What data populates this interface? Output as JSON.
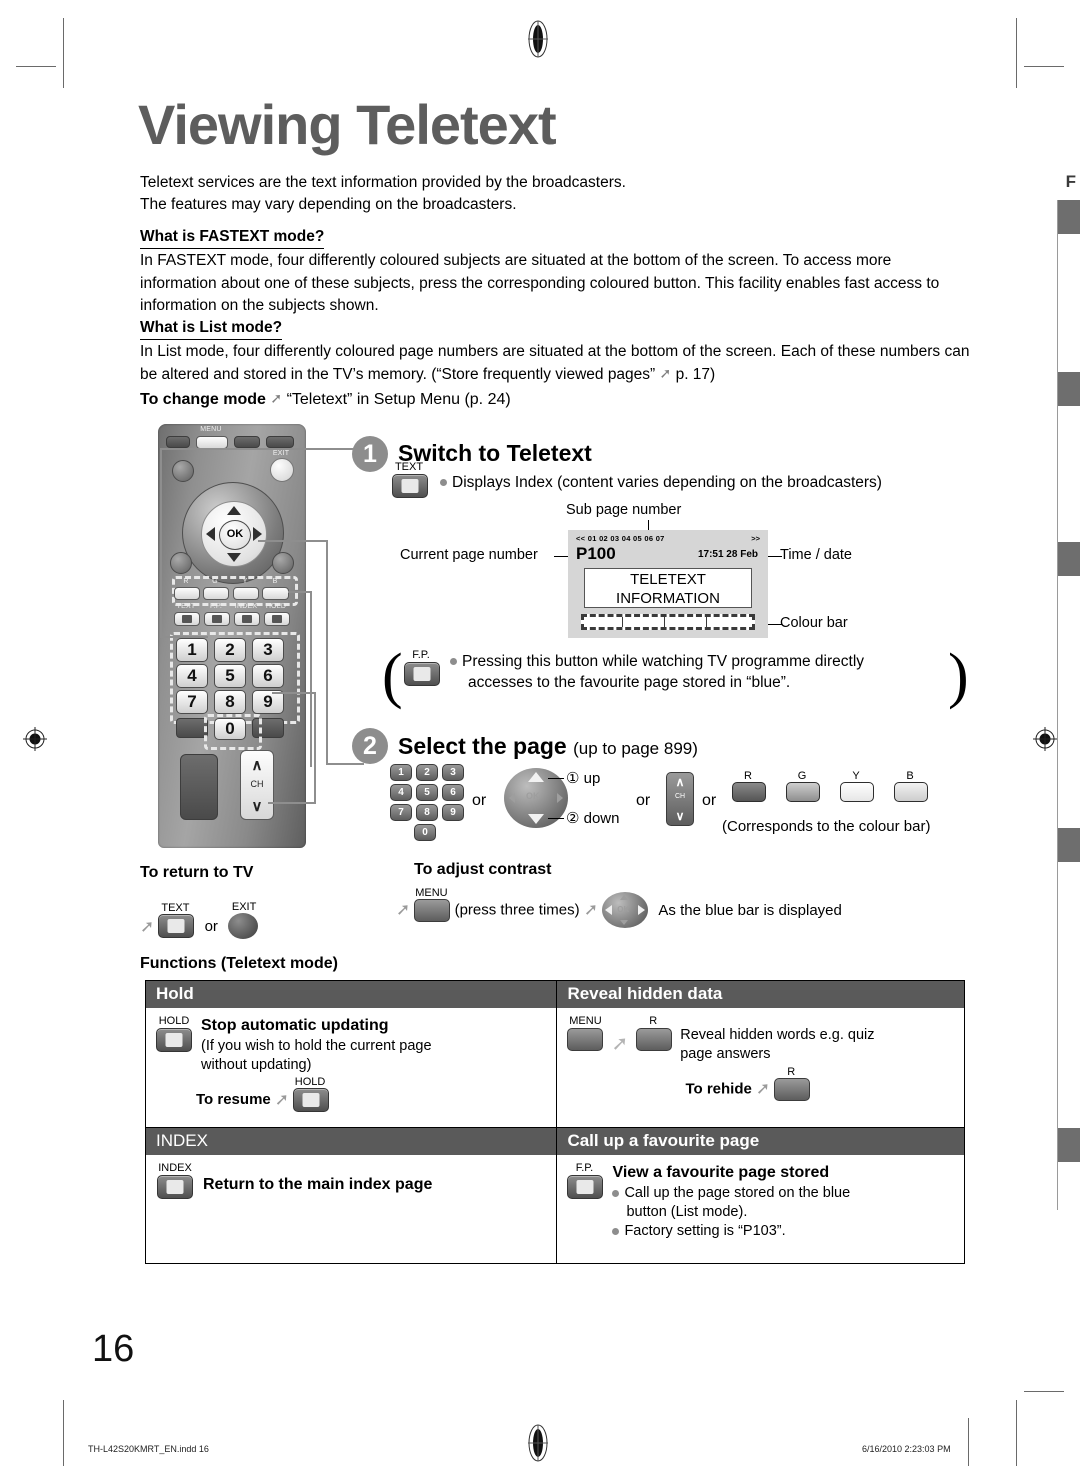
{
  "page": {
    "title": "Viewing Teletext",
    "number": "16",
    "footer_left": "TH-L42S20KMRT_EN.indd   16",
    "footer_right": "6/16/2010   2:23:03 PM",
    "edge_letter": "F"
  },
  "intro": {
    "line1": "Teletext services are the text information provided by the broadcasters.",
    "line2": "The features may vary depending on the broadcasters."
  },
  "fastext": {
    "heading": "What is FASTEXT mode?",
    "body": "In FASTEXT mode, four differently coloured subjects are situated at the bottom of the screen. To access more information about one of these subjects, press the corresponding coloured button. This facility enables fast access to information on the subjects shown."
  },
  "list_mode": {
    "heading": "What is List mode?",
    "body_1": "In List mode, four differently coloured page numbers are situated at the bottom of the screen. Each of these numbers can be altered and stored in the TV’s memory. (“Store frequently viewed pages”",
    "body_2": "p. 17)"
  },
  "change_mode": {
    "label": "To change mode",
    "value": "“Teletext” in Setup Menu (p. 24)"
  },
  "remote": {
    "menu_label": "MENU",
    "exit_label": "EXIT",
    "ok_label": "OK",
    "colour_labels": [
      "R",
      "G",
      "Y",
      "B"
    ],
    "function_labels": [
      "TEXT",
      "F.P.",
      "INDEX",
      "HOLD"
    ],
    "numbers": [
      "1",
      "2",
      "3",
      "4",
      "5",
      "6",
      "7",
      "8",
      "9",
      "0"
    ],
    "ch_label": "CH"
  },
  "step1": {
    "badge": "1",
    "title": "Switch to Teletext",
    "button_cap": "TEXT",
    "bullet": "Displays Index (content varies depending on the broadcasters)",
    "fp_cap": "F.P.",
    "fp_note_1": "Pressing this button while watching TV programme directly",
    "fp_note_2": "accesses to the favourite page stored in “blue”."
  },
  "tv_screen": {
    "sub_page_caption": "Sub page number",
    "sub_page_row": "<< 01 02 03 04 05 06 07",
    "nav_right": ">>",
    "current_page_caption": "Current page number",
    "page_number": "P100",
    "time_date_caption": "Time / date",
    "time_date": "17:51 28 Feb",
    "body_line1": "TELETEXT",
    "body_line2": "INFORMATION",
    "colour_bar_caption": "Colour bar"
  },
  "step2": {
    "badge": "2",
    "title": "Select the page",
    "title_note": "(up to page 899)",
    "or_1": "or",
    "or_2": "or",
    "or_3": "or",
    "up_label": "① up",
    "down_label": "② down",
    "ch_label": "CH",
    "colour_labels": [
      "R",
      "G",
      "Y",
      "B"
    ],
    "colour_note": "(Corresponds to the colour bar)",
    "keypad": [
      "1",
      "2",
      "3",
      "4",
      "5",
      "6",
      "7",
      "8",
      "9",
      "0"
    ]
  },
  "return_to_tv": {
    "heading": "To return to TV",
    "text_cap": "TEXT",
    "or": "or",
    "exit_cap": "EXIT"
  },
  "adjust_contrast": {
    "heading": "To adjust contrast",
    "menu_cap": "MENU",
    "press_three": "(press three times)",
    "note": "As the blue bar is displayed"
  },
  "functions": {
    "heading": "Functions (Teletext mode)",
    "rows": [
      {
        "left_head": "Hold",
        "right_head": "Reveal hidden data"
      },
      {
        "left_head": "INDEX",
        "right_head": "Call up a favourite page"
      }
    ],
    "hold": {
      "button_cap": "HOLD",
      "title": "Stop automatic updating",
      "note_1": "(If you wish to hold the current page",
      "note_2": "without updating)",
      "resume_label": "To resume",
      "resume_cap": "HOLD"
    },
    "reveal": {
      "menu_cap": "MENU",
      "r_cap": "R",
      "text_1": "Reveal hidden words e.g. quiz",
      "text_2": "page answers",
      "rehide_label": "To rehide",
      "rehide_cap": "R"
    },
    "index": {
      "button_cap": "INDEX",
      "title": "Return to the main index page"
    },
    "favourite": {
      "button_cap": "F.P.",
      "title": "View a favourite page stored",
      "bullet_1a": "Call up the page stored on the blue",
      "bullet_1b": "button (List mode).",
      "bullet_2": "Factory setting is “P103”."
    }
  }
}
